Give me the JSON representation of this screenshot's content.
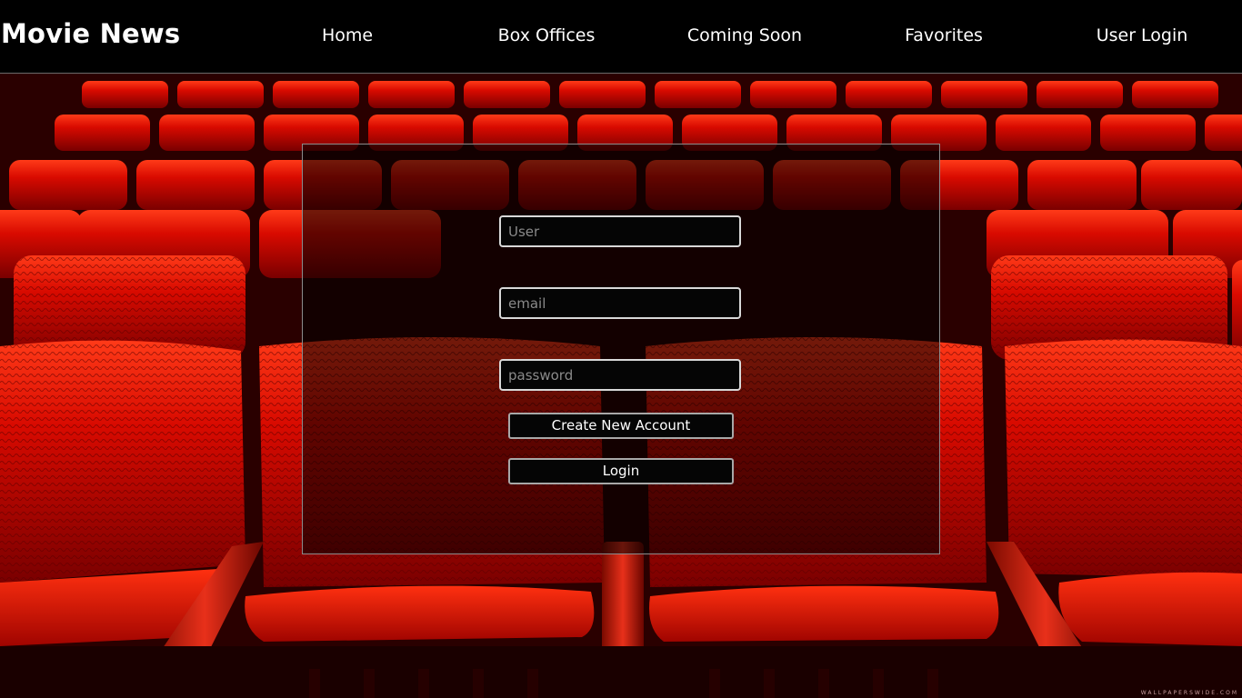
{
  "navbar": {
    "brand": "Movie News",
    "links": [
      {
        "label": "Home"
      },
      {
        "label": "Box Offices"
      },
      {
        "label": "Coming Soon"
      },
      {
        "label": "Favorites"
      },
      {
        "label": "User Login"
      }
    ]
  },
  "login_form": {
    "user_placeholder": "User",
    "email_placeholder": "email",
    "password_placeholder": "password",
    "create_account_label": "Create New Account",
    "login_label": "Login"
  },
  "background": {
    "watermark": "WALLPAPERSWIDE.COM",
    "seat_color": "#c40800",
    "seat_highlight": "#ff2a10"
  }
}
